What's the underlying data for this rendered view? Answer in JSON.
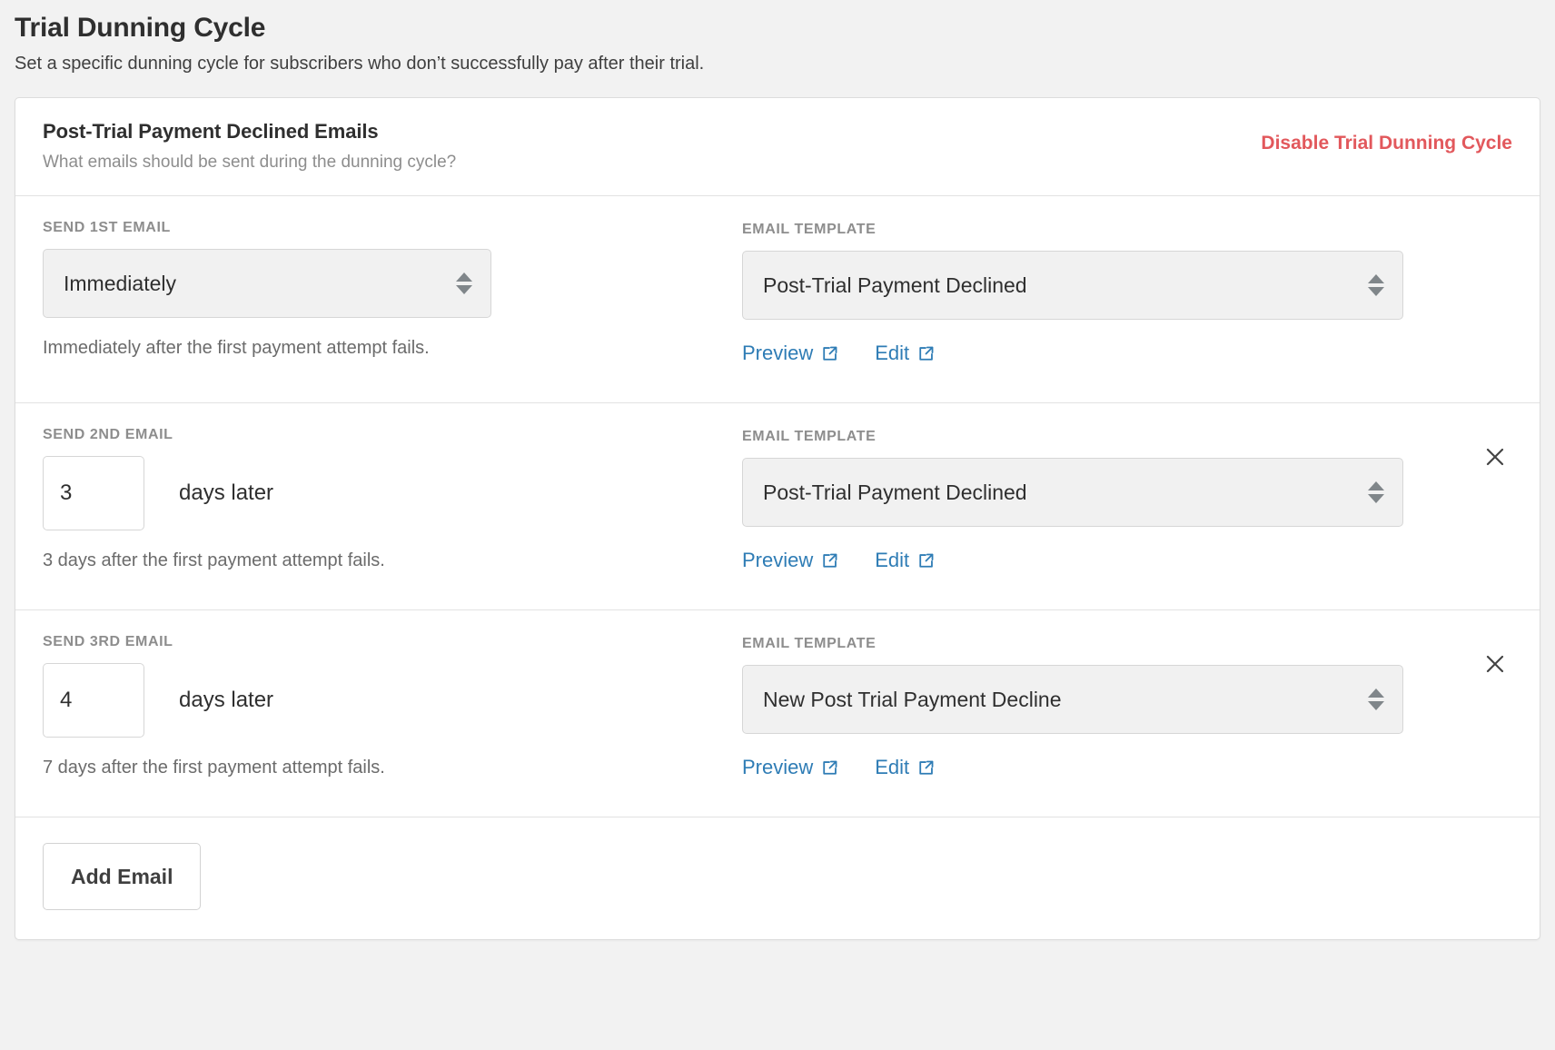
{
  "page": {
    "title": "Trial Dunning Cycle",
    "subtitle": "Set a specific dunning cycle for subscribers who don’t successfully pay after their trial."
  },
  "card": {
    "header": {
      "title": "Post-Trial Payment Declined Emails",
      "subtitle": "What emails should be sent during the dunning cycle?",
      "disable_link": "Disable Trial Dunning Cycle"
    },
    "labels": {
      "email_template": "EMAIL TEMPLATE",
      "days_later": "days later",
      "preview": "Preview",
      "edit": "Edit",
      "close_icon": "×"
    },
    "rows": [
      {
        "schedule_label": "SEND 1ST EMAIL",
        "schedule_type": "select",
        "schedule_value": "Immediately",
        "days_value": "",
        "help_text": "Immediately after the first payment attempt fails.",
        "template_label": "EMAIL TEMPLATE",
        "template_value": "Post-Trial Payment Declined",
        "preview_label": "Preview",
        "edit_label": "Edit",
        "removable": false
      },
      {
        "schedule_label": "SEND 2ND EMAIL",
        "schedule_type": "number",
        "schedule_value": "",
        "days_value": "3",
        "days_suffix": "days later",
        "help_text": "3 days after the first payment attempt fails.",
        "template_label": "EMAIL TEMPLATE",
        "template_value": "Post-Trial Payment Declined",
        "preview_label": "Preview",
        "edit_label": "Edit",
        "removable": true
      },
      {
        "schedule_label": "SEND 3RD EMAIL",
        "schedule_type": "number",
        "schedule_value": "",
        "days_value": "4",
        "days_suffix": "days later",
        "help_text": "7 days after the first payment attempt fails.",
        "template_label": "EMAIL TEMPLATE",
        "template_value": "New Post Trial Payment Decline",
        "preview_label": "Preview",
        "edit_label": "Edit",
        "removable": true
      }
    ],
    "footer": {
      "add_email_label": "Add Email"
    }
  },
  "colors": {
    "page_background": "#f2f2f2",
    "card_background": "#ffffff",
    "border": "#e2e2e2",
    "danger_link": "#e2585c",
    "link_blue": "#2e7cb5",
    "label_gray": "#8d8d8d",
    "text_dark": "#2f2f2f",
    "select_background": "#f1f1f1"
  }
}
